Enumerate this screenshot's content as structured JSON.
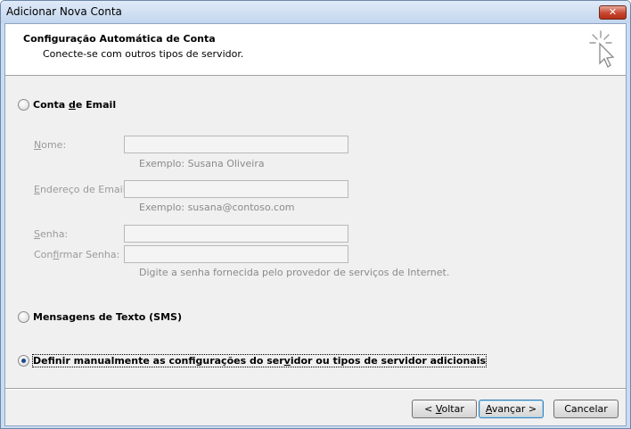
{
  "window": {
    "title": "Adicionar Nova Conta",
    "close_glyph": "✕"
  },
  "header": {
    "title": "Configuração Automática de Conta",
    "subtitle": "Conecte-se com outros tipos de servidor."
  },
  "options": {
    "email": {
      "pre": "Conta ",
      "accel": "d",
      "post": "e Email",
      "checked": false
    },
    "sms": {
      "label": "Mensagens de Texto (SMS)",
      "checked": false
    },
    "manual": {
      "pre": "Definir manualmente as configurações do ser",
      "accel": "v",
      "post": "idor ou tipos de servidor adicionais",
      "checked": true
    }
  },
  "fields": {
    "name": {
      "pre": "",
      "accel": "N",
      "post": "ome:",
      "hint": "Exemplo: Susana Oliveira",
      "value": ""
    },
    "email": {
      "pre": "",
      "accel": "E",
      "post": "ndereço de Email:",
      "hint": "Exemplo: susana@contoso.com",
      "value": ""
    },
    "password": {
      "pre": "",
      "accel": "S",
      "post": "enha:",
      "value": ""
    },
    "confirm": {
      "pre": "Con",
      "accel": "f",
      "post": "irmar Senha:",
      "hint": "Digite a senha fornecida pelo provedor de serviços de Internet.",
      "value": ""
    }
  },
  "buttons": {
    "back": {
      "pre": "< ",
      "accel": "V",
      "post": "oltar"
    },
    "next": {
      "pre": "",
      "accel": "A",
      "post": "vançar >"
    },
    "cancel": {
      "label": "Cancelar"
    }
  },
  "icons": {
    "wizard": "cursor-sparkle-icon",
    "close": "close-icon"
  },
  "colors": {
    "title_bar": "#c9dcf2",
    "close_button": "#c7462f",
    "disabled_text": "#9a9a9a"
  }
}
